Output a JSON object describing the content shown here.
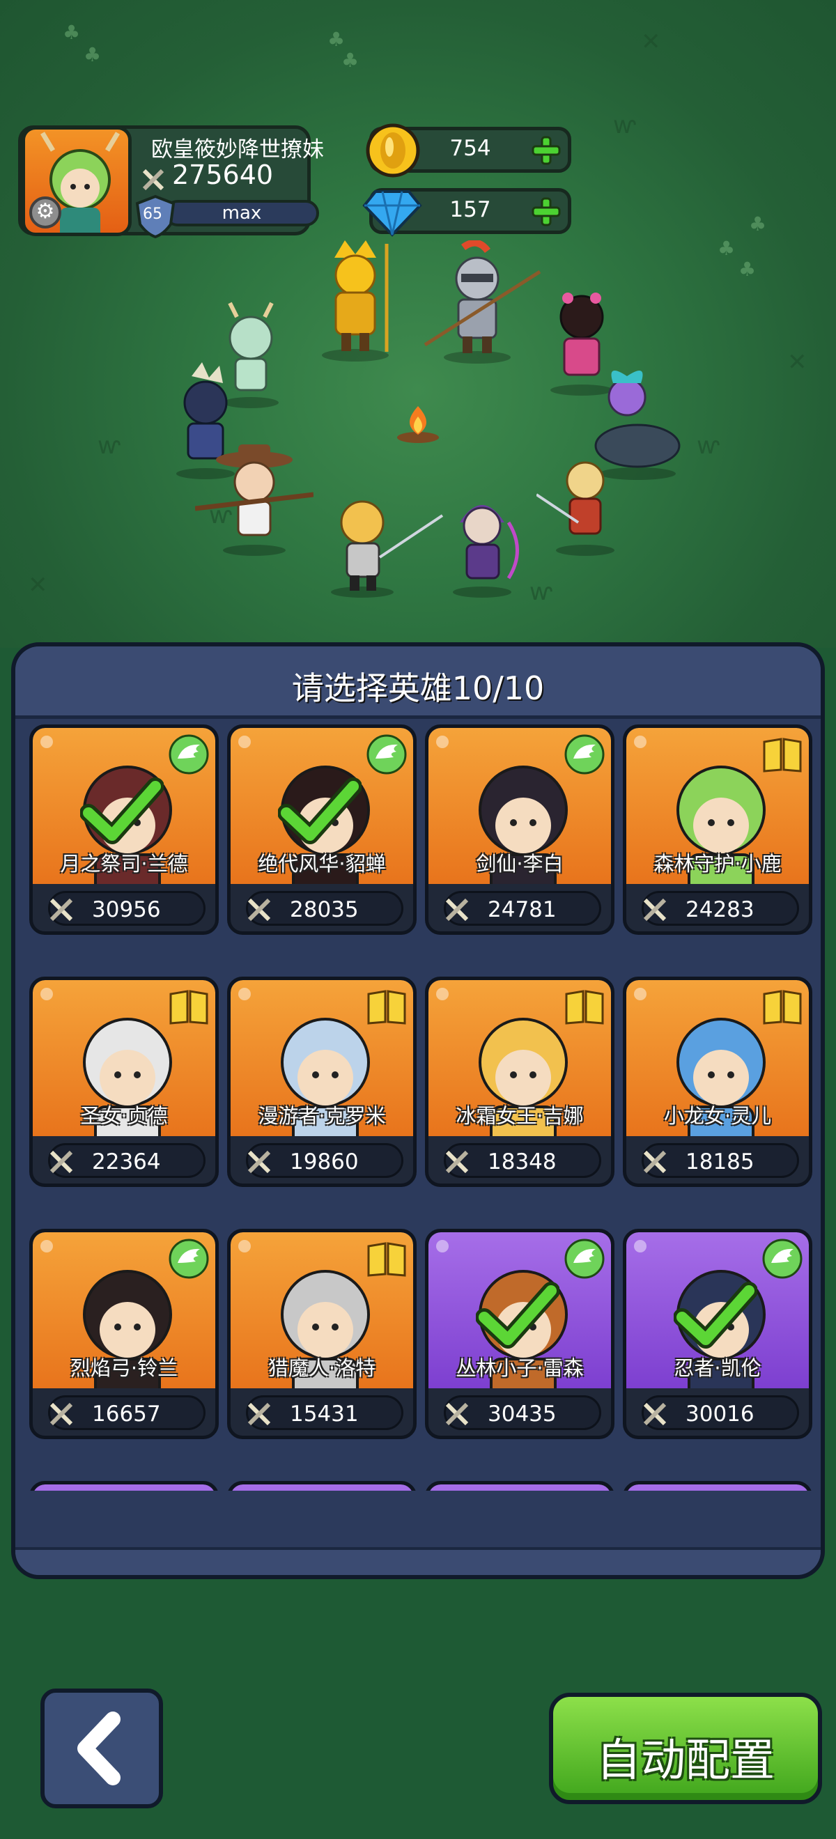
{
  "player": {
    "name": "欧皇筱妙降世撩妹",
    "power": "275640",
    "level": "65",
    "level_bar": "max"
  },
  "currency": {
    "gold": "754",
    "diamond": "157"
  },
  "panel": {
    "title": "请选择英雄10/10"
  },
  "heroes": [
    {
      "name": "月之祭司·兰德",
      "power": "30956",
      "selected": true,
      "badge": "wing",
      "bg": "orange"
    },
    {
      "name": "绝代风华·貂蝉",
      "power": "28035",
      "selected": true,
      "badge": "wing",
      "bg": "orange"
    },
    {
      "name": "剑仙·李白",
      "power": "24781",
      "selected": false,
      "badge": "wing",
      "bg": "orange"
    },
    {
      "name": "森林守护·小鹿",
      "power": "24283",
      "selected": false,
      "badge": "book",
      "bg": "orange"
    },
    {
      "name": "圣女·贞德",
      "power": "22364",
      "selected": false,
      "badge": "book",
      "bg": "orange"
    },
    {
      "name": "漫游者·克罗米",
      "power": "19860",
      "selected": false,
      "badge": "book",
      "bg": "orange"
    },
    {
      "name": "冰霜女王·吉娜",
      "power": "18348",
      "selected": false,
      "badge": "book",
      "bg": "orange"
    },
    {
      "name": "小龙女·灵儿",
      "power": "18185",
      "selected": false,
      "badge": "book",
      "bg": "orange"
    },
    {
      "name": "烈焰弓·铃兰",
      "power": "16657",
      "selected": false,
      "badge": "wing",
      "bg": "orange"
    },
    {
      "name": "猎魔人·洛特",
      "power": "15431",
      "selected": false,
      "badge": "book",
      "bg": "orange"
    },
    {
      "name": "丛林小子·雷森",
      "power": "30435",
      "selected": true,
      "badge": "wing",
      "bg": "purple"
    },
    {
      "name": "忍者·凯伦",
      "power": "30016",
      "selected": true,
      "badge": "wing",
      "bg": "purple"
    },
    {
      "name": "",
      "power": "",
      "selected": false,
      "badge": "wing",
      "bg": "purple"
    },
    {
      "name": "",
      "power": "",
      "selected": false,
      "badge": "wing",
      "bg": "purple"
    },
    {
      "name": "",
      "power": "",
      "selected": false,
      "badge": "wing",
      "bg": "purple"
    },
    {
      "name": "",
      "power": "",
      "selected": false,
      "badge": "wing",
      "bg": "purple"
    }
  ],
  "buttons": {
    "auto": "自动配置",
    "back_icon": "chevron-left-icon"
  },
  "colors": {
    "orange_card": "#e8741c",
    "purple_card": "#7d3fd0",
    "auto_button": "#3fa51c",
    "panel": "#2c3a5c"
  }
}
